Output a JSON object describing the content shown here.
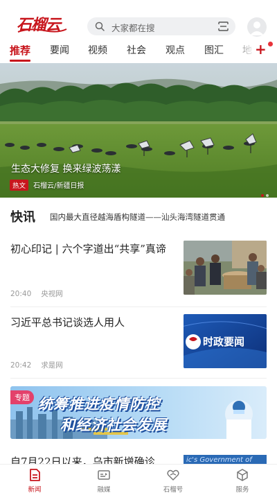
{
  "header": {
    "logo_text": "石榴云",
    "search_placeholder": "大家都在搜"
  },
  "tabs": [
    {
      "label": "推荐",
      "active": true
    },
    {
      "label": "要闻"
    },
    {
      "label": "视频"
    },
    {
      "label": "社会"
    },
    {
      "label": "观点"
    },
    {
      "label": "图汇"
    },
    {
      "label": "地"
    }
  ],
  "banner": {
    "title": "生态大修复  换来绿波荡漾",
    "tag": "热文",
    "source": "石榴云/新疆日报"
  },
  "flash": {
    "label": "快讯",
    "text": "国内最大直径越海盾构隧道——汕头海湾隧道贯通"
  },
  "news": [
    {
      "title": "初心印记 | 六个字道出“共享”真谛",
      "time": "20:40",
      "source": "央视网"
    },
    {
      "title": "习近平总书记谈选人用人",
      "time": "20:42",
      "source": "求是网",
      "thumb_text": "时政要闻"
    }
  ],
  "special": {
    "tag": "专题",
    "line1": "统筹推进疫情防控",
    "line2": "和经济社会发展"
  },
  "partial_news": {
    "title": "自7月22日以来，乌市新增确诊",
    "thumb_text": "ic's Government of"
  },
  "bottom_nav": [
    {
      "label": "新闻",
      "icon": "news-icon",
      "active": true
    },
    {
      "label": "融媒",
      "icon": "media-icon"
    },
    {
      "label": "石榴号",
      "icon": "heart-icon"
    },
    {
      "label": "服务",
      "icon": "box-icon"
    }
  ],
  "colors": {
    "brand_red": "#c8161d",
    "special_pink": "#e3416b",
    "special_blue": "#1d4e9e"
  }
}
